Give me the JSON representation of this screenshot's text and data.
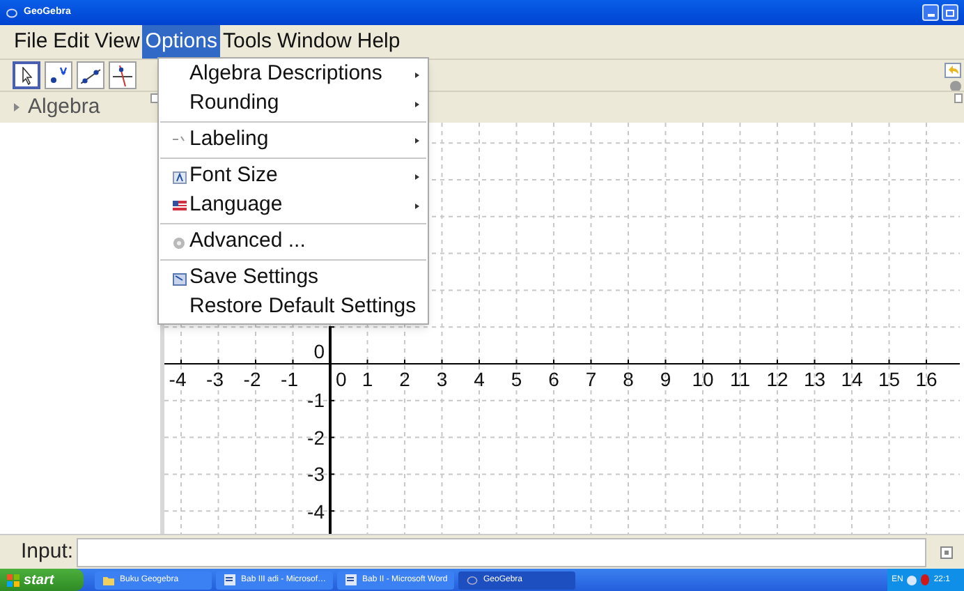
{
  "window": {
    "title": "GeoGebra"
  },
  "menu_bar": [
    {
      "label": "File",
      "selected": false
    },
    {
      "label": "Edit",
      "selected": false
    },
    {
      "label": "View",
      "selected": false
    },
    {
      "label": "Options",
      "selected": true
    },
    {
      "label": "Tools",
      "selected": false
    },
    {
      "label": "Window",
      "selected": false
    },
    {
      "label": "Help",
      "selected": false
    }
  ],
  "options_menu": [
    {
      "label": "Algebra Descriptions",
      "kind": "plain",
      "submenu": true,
      "separator_before": false
    },
    {
      "label": "Rounding",
      "kind": "plain",
      "submenu": true,
      "separator_before": false
    },
    {
      "label": "Labeling",
      "kind": "labeling",
      "submenu": true,
      "separator_before": true
    },
    {
      "label": "Font Size",
      "kind": "font",
      "submenu": true,
      "separator_before": true
    },
    {
      "label": "Language",
      "kind": "language",
      "submenu": true,
      "separator_before": false
    },
    {
      "label": "Advanced ...",
      "kind": "advanced",
      "submenu": false,
      "separator_before": true
    },
    {
      "label": "Save Settings",
      "kind": "save",
      "submenu": false,
      "separator_before": true
    },
    {
      "label": "Restore Default Settings",
      "kind": "plain",
      "submenu": false,
      "separator_before": false
    }
  ],
  "toolbar": [
    {
      "kind": "pointer",
      "selected": true
    },
    {
      "kind": "point",
      "selected": false
    },
    {
      "kind": "line",
      "selected": false
    },
    {
      "kind": "perpendicular",
      "selected": false
    }
  ],
  "algebra_view": {
    "title": "Algebra"
  },
  "graphics_view": {
    "x_labels": [
      "-4",
      "-3",
      "-2",
      "-1",
      "0",
      "1",
      "2",
      "3",
      "4",
      "5",
      "6",
      "7",
      "8",
      "9",
      "10",
      "11",
      "12",
      "13",
      "14",
      "15",
      "16"
    ],
    "y_labels": [
      "0",
      "-1",
      "-2",
      "-3",
      "-4"
    ]
  },
  "input_bar": {
    "label": "Input:"
  },
  "taskbar": {
    "start": "start",
    "tasks": [
      {
        "label": "Buku Geogebra",
        "kind": "folder",
        "selected": false
      },
      {
        "label": "Bab III adi - Microsof…",
        "kind": "word",
        "selected": false
      },
      {
        "label": "Bab II - Microsoft Word",
        "kind": "word",
        "selected": false
      },
      {
        "label": "GeoGebra",
        "kind": "app",
        "selected": true
      }
    ],
    "language": "EN",
    "clock": "22:1"
  }
}
